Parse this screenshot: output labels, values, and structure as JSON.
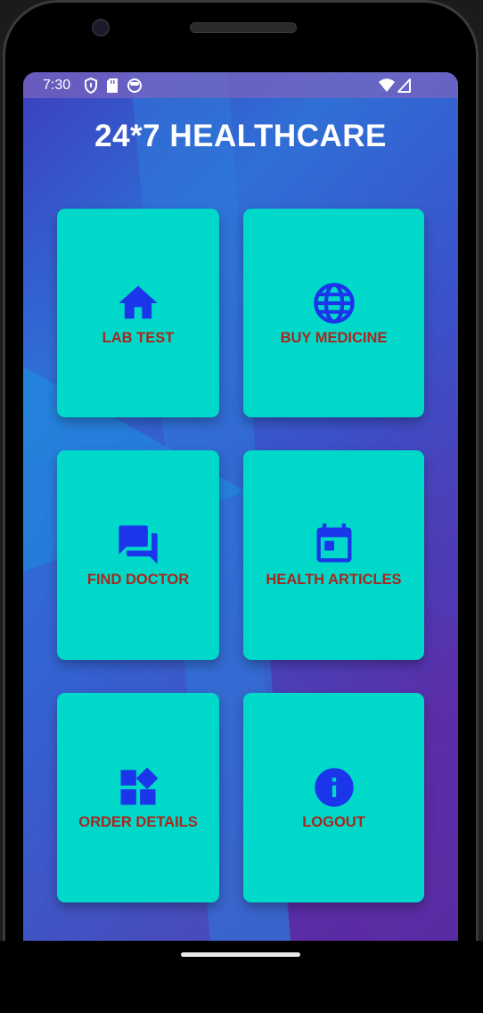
{
  "status_bar": {
    "time": "7:30"
  },
  "app": {
    "title": "24*7 HEALTHCARE"
  },
  "theme": {
    "card_color": "#00d9c9",
    "label_color": "#a8271f",
    "icon_color": "#1b35ea",
    "title_color": "#ffffff"
  },
  "menu": {
    "lab_test": {
      "label": "LAB TEST",
      "icon": "home-icon"
    },
    "buy_medicine": {
      "label": "BUY MEDICINE",
      "icon": "globe-icon"
    },
    "find_doctor": {
      "label": "FIND DOCTOR",
      "icon": "chat-icon"
    },
    "health_articles": {
      "label": "HEALTH ARTICLES",
      "icon": "calendar-icon"
    },
    "order_details": {
      "label": "ORDER DETAILS",
      "icon": "widgets-icon"
    },
    "logout": {
      "label": "LOGOUT",
      "icon": "info-icon"
    }
  }
}
